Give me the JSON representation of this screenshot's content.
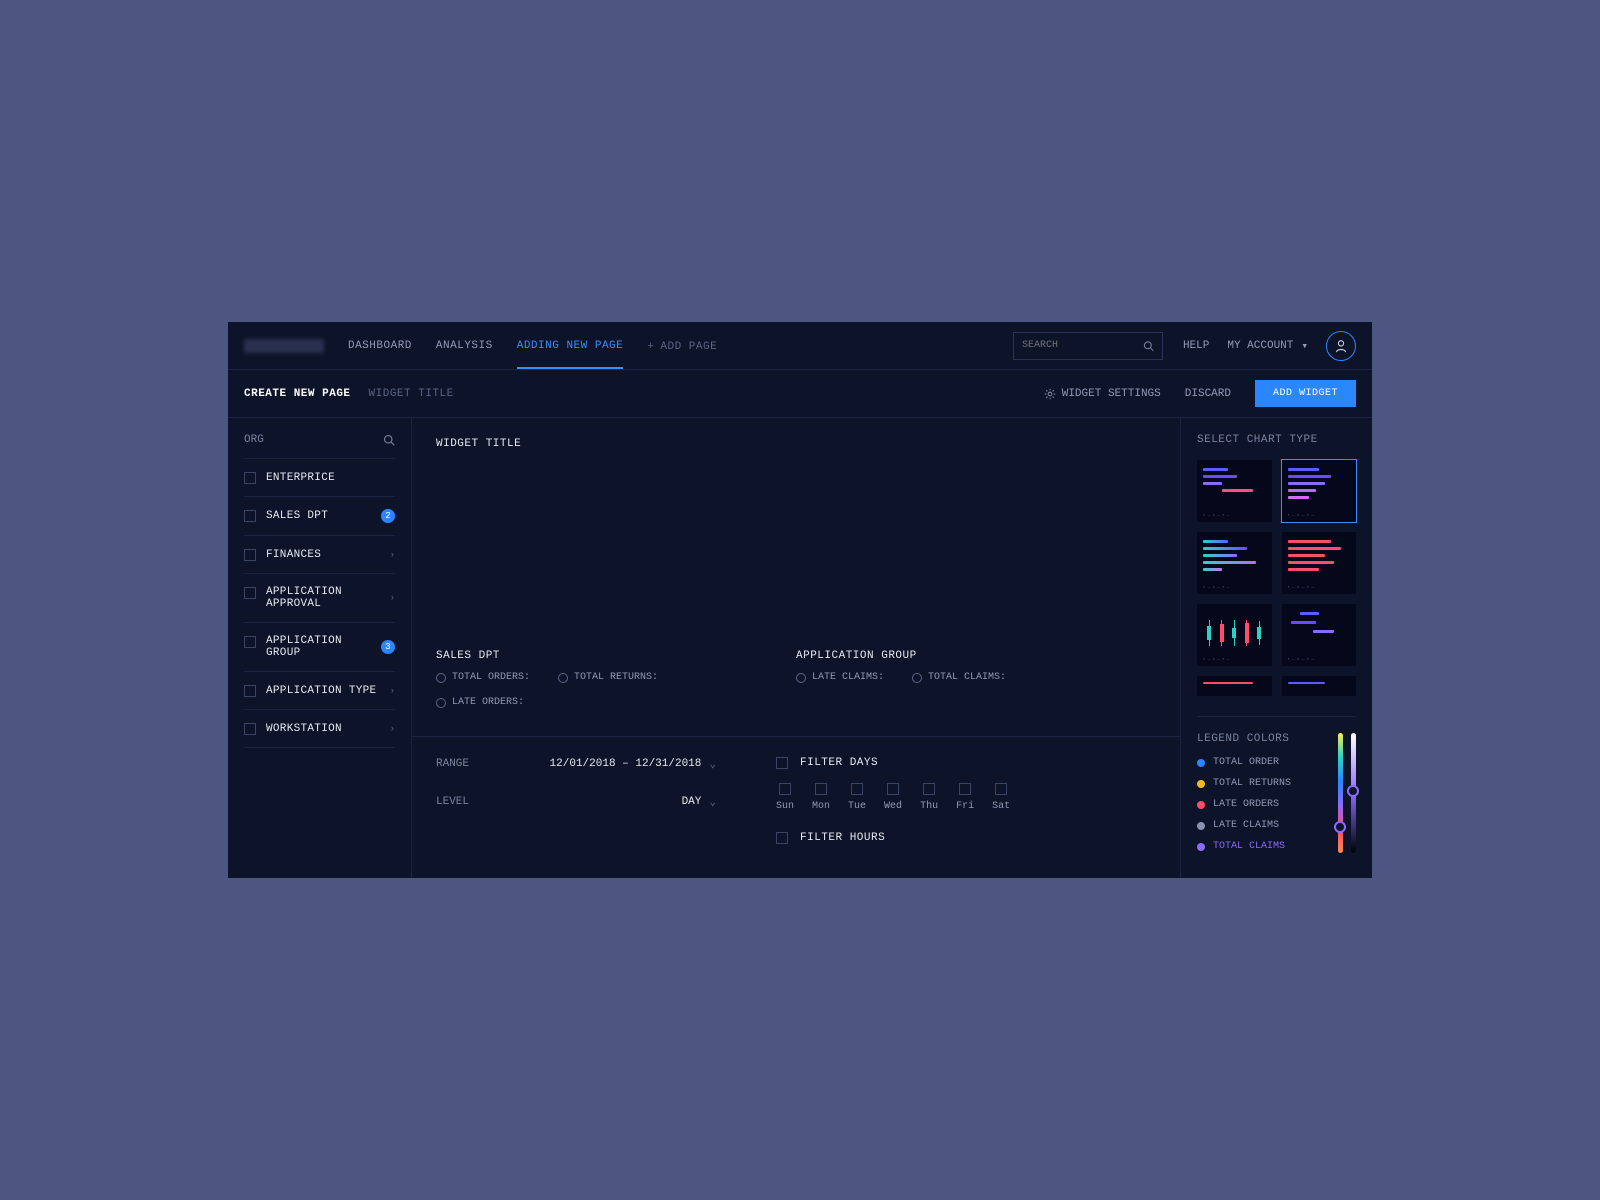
{
  "nav": {
    "items": [
      "DASHBOARD",
      "ANALYSIS",
      "ADDING NEW PAGE"
    ],
    "add_label": "ADD PAGE"
  },
  "search": {
    "placeholder": "SEARCH"
  },
  "top": {
    "help": "HELP",
    "account": "MY ACCOUNT"
  },
  "subheader": {
    "title": "CREATE NEW PAGE",
    "subtitle": "WIDGET TITLE",
    "settings": "WIDGET SETTINGS",
    "discard": "DISCARD",
    "add_widget": "ADD WIDGET"
  },
  "sidebar": {
    "header": "ORG",
    "items": [
      {
        "label": "ENTERPRICE"
      },
      {
        "label": "SALES DPT",
        "badge": "2"
      },
      {
        "label": "FINANCES",
        "expandable": true
      },
      {
        "label": "APPLICATION APPROVAL",
        "expandable": true
      },
      {
        "label": "APPLICATION GROUP",
        "badge": "3"
      },
      {
        "label": "APPLICATION TYPE",
        "expandable": true
      },
      {
        "label": "WORKSTATION",
        "expandable": true
      }
    ]
  },
  "widget": {
    "title": "WIDGET TITLE",
    "groups": [
      {
        "name": "SALES DPT",
        "radios": [
          "TOTAL ORDERS:",
          "TOTAL RETURNS:",
          "LATE ORDERS:"
        ]
      },
      {
        "name": "APPLICATION GROUP",
        "radios": [
          "LATE CLAIMS:",
          "TOTAL CLAIMS:"
        ]
      }
    ]
  },
  "controls": {
    "range_label": "RANGE",
    "range_value": "12/01/2018 – 12/31/2018",
    "level_label": "LEVEL",
    "level_value": "DAY",
    "filter_days": "FILTER DAYS",
    "filter_hours": "FILTER HOURS",
    "days": [
      "Sun",
      "Mon",
      "Tue",
      "Wed",
      "Thu",
      "Fri",
      "Sat"
    ]
  },
  "right": {
    "select_title": "SELECT CHART TYPE",
    "legend_title": "LEGEND COLORS",
    "legend": [
      {
        "label": "TOTAL ORDER",
        "color": "#2a87ff"
      },
      {
        "label": "TOTAL RETURNS",
        "color": "#f5b923"
      },
      {
        "label": "LATE ORDERS",
        "color": "#ff4d6a"
      },
      {
        "label": "LATE CLAIMS",
        "color": "#8a93ad"
      },
      {
        "label": "TOTAL CLAIMS",
        "color": "#8b6bff",
        "active": true
      }
    ]
  }
}
